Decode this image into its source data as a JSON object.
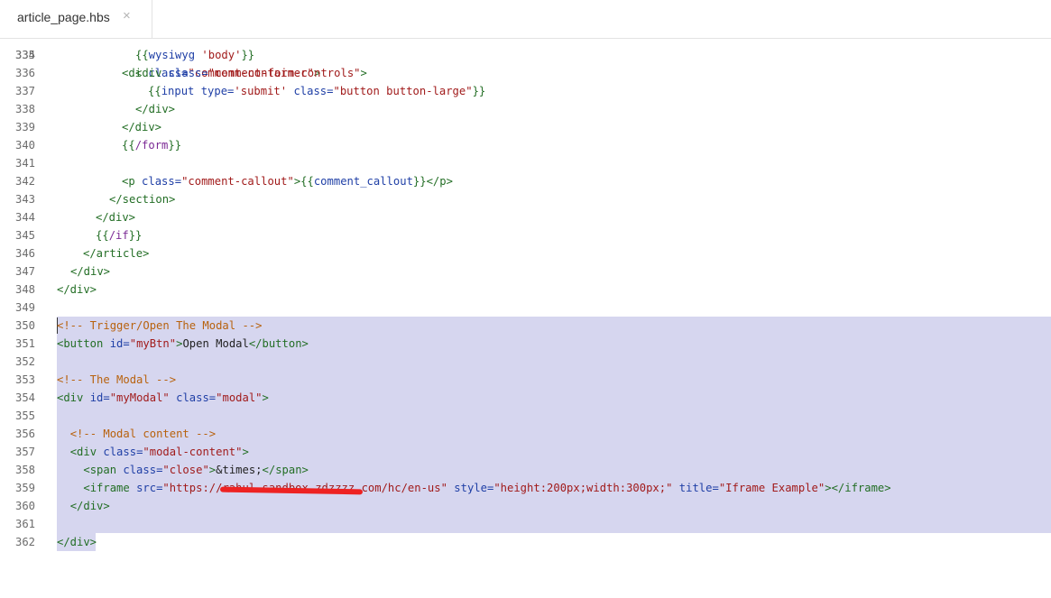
{
  "tab": {
    "title": "article_page.hbs",
    "close": "×"
  },
  "editor": {
    "partial_line": {
      "number": "334",
      "pre": "<di",
      "attr": " class=",
      "str": "\"comment-container\"",
      "tail": ">"
    },
    "lines": [
      {
        "n": "335",
        "segments": [
          [
            "txt",
            "      "
          ],
          [
            "hb",
            "{{"
          ],
          [
            "hbv",
            "wysiwyg"
          ],
          [
            "str",
            " 'body'"
          ],
          [
            "hb",
            "}}"
          ]
        ]
      },
      {
        "n": "336",
        "segments": [
          [
            "txt",
            "      "
          ],
          [
            "tag",
            "<div"
          ],
          [
            "attr",
            " class="
          ],
          [
            "str",
            "\"comment-form-controls\""
          ],
          [
            "tag",
            ">"
          ]
        ]
      },
      {
        "n": "337",
        "segments": [
          [
            "txt",
            "        "
          ],
          [
            "hb",
            "{{"
          ],
          [
            "hbv",
            "input"
          ],
          [
            "attr",
            " type="
          ],
          [
            "str",
            "'submit'"
          ],
          [
            "attr",
            " class="
          ],
          [
            "str",
            "\"button button-large\""
          ],
          [
            "hb",
            "}}"
          ]
        ]
      },
      {
        "n": "338",
        "segments": [
          [
            "txt",
            "      "
          ],
          [
            "tag",
            "</div>"
          ]
        ]
      },
      {
        "n": "339",
        "segments": [
          [
            "txt",
            "    "
          ],
          [
            "tag",
            "</div>"
          ]
        ]
      },
      {
        "n": "340",
        "segments": [
          [
            "txt",
            "    "
          ],
          [
            "hb",
            "{{"
          ],
          [
            "hbk",
            "/form"
          ],
          [
            "hb",
            "}}"
          ]
        ]
      },
      {
        "n": "341",
        "segments": []
      },
      {
        "n": "342",
        "segments": [
          [
            "txt",
            "    "
          ],
          [
            "tag",
            "<p"
          ],
          [
            "attr",
            " class="
          ],
          [
            "str",
            "\"comment-callout\""
          ],
          [
            "tag",
            ">"
          ],
          [
            "hb",
            "{{"
          ],
          [
            "hbv",
            "comment_callout"
          ],
          [
            "hb",
            "}}"
          ],
          [
            "tag",
            "</p>"
          ]
        ]
      },
      {
        "n": "343",
        "segments": [
          [
            "txt",
            "  "
          ],
          [
            "tag",
            "</section>"
          ]
        ]
      },
      {
        "n": "344",
        "segments": [
          [
            "txt",
            "  "
          ],
          [
            "tag",
            "</div>"
          ]
        ]
      },
      {
        "n": "345",
        "segments": [
          [
            "txt",
            "  "
          ],
          [
            "hb",
            "{{"
          ],
          [
            "hbk",
            "/if"
          ],
          [
            "hb",
            "}}"
          ]
        ]
      },
      {
        "n": "346",
        "segments": [
          [
            "txt",
            "  "
          ],
          [
            "tag",
            "</article>"
          ]
        ]
      },
      {
        "n": "347",
        "segments": [
          [
            "txt",
            "  "
          ],
          [
            "tag",
            "</div>"
          ]
        ]
      },
      {
        "n": "348",
        "segments": [
          [
            "tag",
            "</div>"
          ]
        ]
      },
      {
        "n": "349",
        "segments": []
      },
      {
        "n": "350",
        "segments": [
          [
            "cmt",
            "<!-- Trigger/Open The Modal -->"
          ]
        ]
      },
      {
        "n": "351",
        "segments": [
          [
            "tag",
            "<button"
          ],
          [
            "attr",
            " id="
          ],
          [
            "str",
            "\"myBtn\""
          ],
          [
            "tag",
            ">"
          ],
          [
            "txt",
            "Open Modal"
          ],
          [
            "tag",
            "</button>"
          ]
        ]
      },
      {
        "n": "352",
        "segments": []
      },
      {
        "n": "353",
        "segments": [
          [
            "cmt",
            "<!-- The Modal -->"
          ]
        ]
      },
      {
        "n": "354",
        "segments": [
          [
            "tag",
            "<div"
          ],
          [
            "attr",
            " id="
          ],
          [
            "str",
            "\"myModal\""
          ],
          [
            "attr",
            " class="
          ],
          [
            "str",
            "\"modal\""
          ],
          [
            "tag",
            ">"
          ]
        ]
      },
      {
        "n": "355",
        "segments": []
      },
      {
        "n": "356",
        "segments": [
          [
            "txt",
            "  "
          ],
          [
            "cmt",
            "<!-- Modal content -->"
          ]
        ]
      },
      {
        "n": "357",
        "segments": [
          [
            "txt",
            "  "
          ],
          [
            "tag",
            "<div"
          ],
          [
            "attr",
            " class="
          ],
          [
            "str",
            "\"modal-content\""
          ],
          [
            "tag",
            ">"
          ]
        ]
      },
      {
        "n": "358",
        "segments": [
          [
            "txt",
            "    "
          ],
          [
            "tag",
            "<span"
          ],
          [
            "attr",
            " class="
          ],
          [
            "str",
            "\"close\""
          ],
          [
            "tag",
            ">"
          ],
          [
            "txt",
            "&times;"
          ],
          [
            "tag",
            "</span>"
          ]
        ]
      },
      {
        "n": "359",
        "segments": [
          [
            "txt",
            "    "
          ],
          [
            "tag",
            "<iframe"
          ],
          [
            "attr",
            " src="
          ],
          [
            "str",
            "\"https://"
          ],
          [
            "redact",
            "rahul-sandbox.zdzzzz."
          ],
          [
            "str",
            "com/hc/en-us\""
          ],
          [
            "attr",
            " style="
          ],
          [
            "str",
            "\"height:200px;width:300px;\""
          ],
          [
            "attr",
            " title="
          ],
          [
            "str",
            "\"Iframe Example\""
          ],
          [
            "tag",
            "></iframe>"
          ]
        ]
      },
      {
        "n": "360",
        "segments": [
          [
            "txt",
            "  "
          ],
          [
            "tag",
            "</div>"
          ]
        ]
      },
      {
        "n": "361",
        "segments": []
      },
      {
        "n": "362",
        "segments": [
          [
            "tag",
            "</div>"
          ]
        ]
      }
    ]
  },
  "colors": {
    "selection": "#d6d6ef",
    "tag": "#236e25",
    "attr": "#1f3fa6",
    "string": "#a11b1b",
    "comment": "#b8620e",
    "handlebars_keyword": "#7b2a95",
    "redaction": "#ee2222"
  }
}
